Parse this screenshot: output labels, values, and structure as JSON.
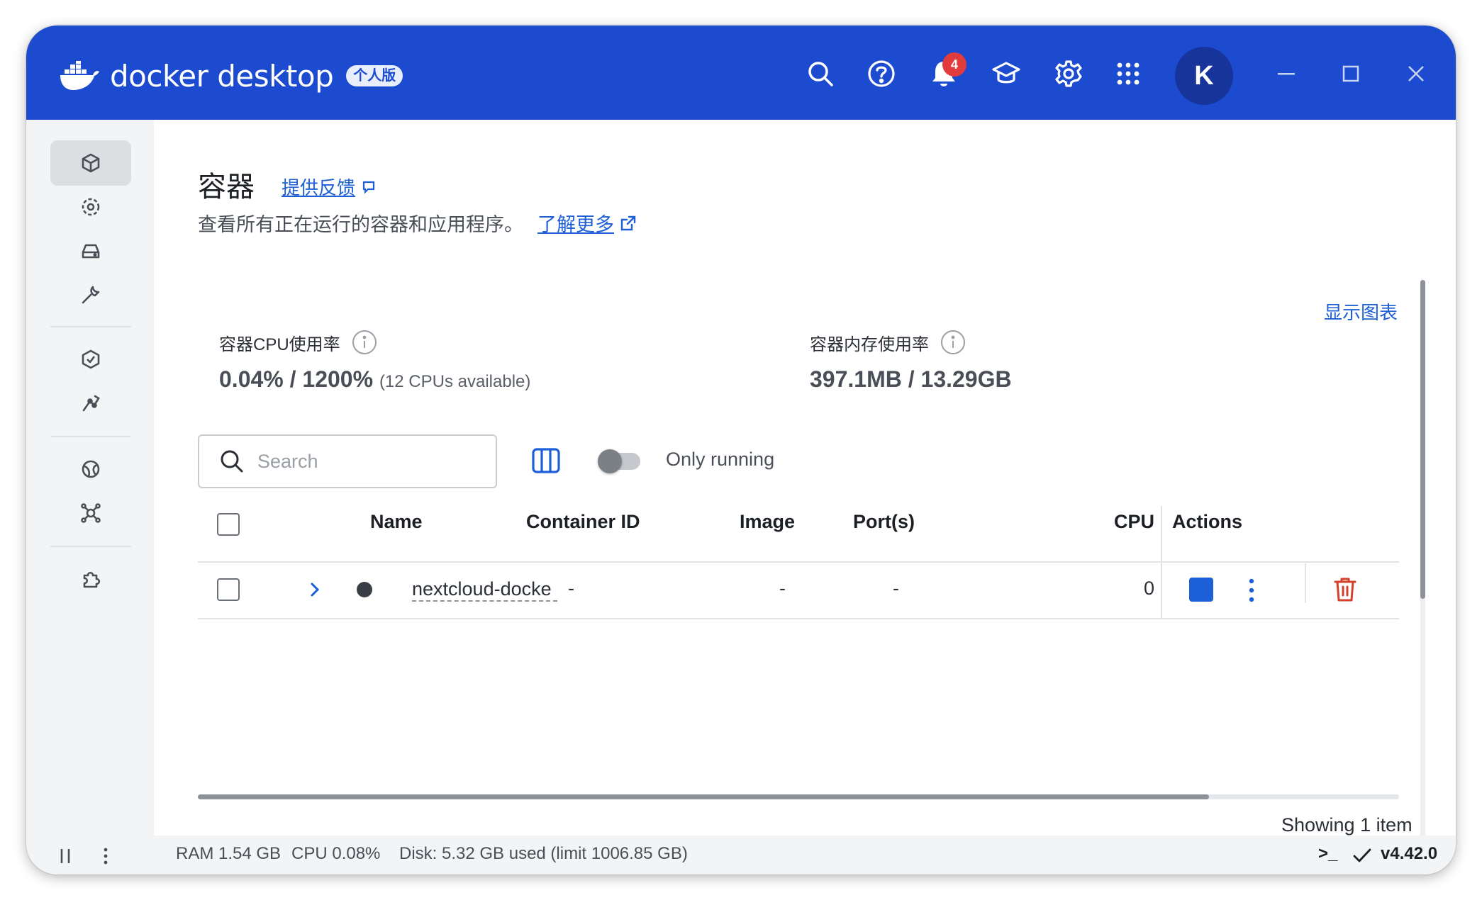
{
  "app": {
    "brand_name": "docker desktop",
    "edition_badge": "个人版",
    "notification_count": "4",
    "avatar_initial": "K",
    "brand_color": "#1d4bd0"
  },
  "titlebar_icons": [
    "search-icon",
    "help-icon",
    "bell-icon",
    "learning-center-icon",
    "gear-icon",
    "apps-grid-icon"
  ],
  "sidebar": {
    "items": [
      {
        "name": "containers-icon",
        "active": true
      },
      {
        "name": "images-icon"
      },
      {
        "name": "volumes-icon"
      },
      {
        "name": "builds-icon"
      },
      {
        "name": "docker-scout-icon"
      },
      {
        "name": "models-icon"
      },
      {
        "name": "docker-hub-icon"
      },
      {
        "name": "mcp-toolkit-icon"
      },
      {
        "name": "extensions-icon"
      }
    ]
  },
  "page": {
    "title": "容器",
    "feedback_link": "提供反馈",
    "subtitle": "查看所有正在运行的容器和应用程序。",
    "learn_more_link": "了解更多"
  },
  "stats": {
    "cpu_label": "容器CPU使用率",
    "cpu_value": "0.04% / 1200%",
    "cpu_extra": "(12 CPUs available)",
    "mem_label": "容器内存使用率",
    "mem_value": "397.1MB / 13.29GB",
    "show_chart_link": "显示图表"
  },
  "filters": {
    "search_placeholder": "Search",
    "only_running_label": "Only running",
    "only_running_on": false
  },
  "table": {
    "columns": [
      "Name",
      "Container ID",
      "Image",
      "Port(s)",
      "CPU",
      "Actions"
    ],
    "rows": [
      {
        "name": "nextcloud-docke",
        "container_id": "-",
        "image": "-",
        "ports": "-",
        "cpu": "0"
      }
    ],
    "showing_text": "Showing 1 item"
  },
  "footer": {
    "ram": "RAM 1.54 GB",
    "cpu": "CPU 0.08%",
    "disk": "Disk: 5.32 GB used (limit 1006.85 GB)",
    "terminal_label": ">_",
    "version": "v4.42.0"
  }
}
